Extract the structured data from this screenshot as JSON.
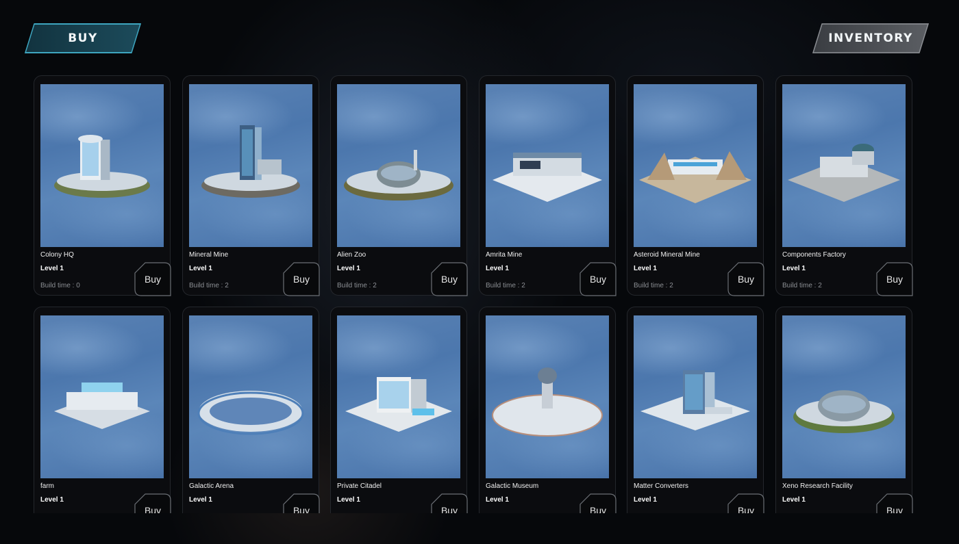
{
  "tabs": {
    "buy": "BUY",
    "inventory": "INVENTORY"
  },
  "colors": {
    "buy_tab": "#1c4b5b",
    "buy_tab_border": "#3ea6c0",
    "inventory_tab": "#5b5e63",
    "card_bg": "#0b0c0f",
    "art_bg": "#5a82b4"
  },
  "cards": [
    {
      "name": "Colony HQ",
      "level": "Level 1",
      "build_time": "Build time : 0",
      "buy": "Buy",
      "icon": "colony-hq-building-icon"
    },
    {
      "name": "Mineral Mine",
      "level": "Level 1",
      "build_time": "Build time : 2",
      "buy": "Buy",
      "icon": "mineral-mine-building-icon"
    },
    {
      "name": "Alien Zoo",
      "level": "Level 1",
      "build_time": "Build time : 2",
      "buy": "Buy",
      "icon": "alien-zoo-building-icon"
    },
    {
      "name": "Amrita Mine",
      "level": "Level 1",
      "build_time": "Build time : 2",
      "buy": "Buy",
      "icon": "amrita-mine-building-icon"
    },
    {
      "name": "Asteroid Mineral Mine",
      "level": "Level 1",
      "build_time": "Build time : 2",
      "buy": "Buy",
      "icon": "asteroid-mine-building-icon"
    },
    {
      "name": "Components Factory",
      "level": "Level 1",
      "build_time": "Build time : 2",
      "buy": "Buy",
      "icon": "components-factory-building-icon"
    },
    {
      "name": "farm",
      "level": "Level 1",
      "build_time": "",
      "buy": "Buy",
      "icon": "farm-building-icon"
    },
    {
      "name": "Galactic Arena",
      "level": "Level 1",
      "build_time": "",
      "buy": "Buy",
      "icon": "galactic-arena-building-icon"
    },
    {
      "name": "Private Citadel",
      "level": "Level 1",
      "build_time": "",
      "buy": "Buy",
      "icon": "private-citadel-building-icon"
    },
    {
      "name": "Galactic Museum",
      "level": "Level 1",
      "build_time": "",
      "buy": "Buy",
      "icon": "galactic-museum-building-icon"
    },
    {
      "name": "Matter Converters",
      "level": "Level 1",
      "build_time": "",
      "buy": "Buy",
      "icon": "matter-converters-building-icon"
    },
    {
      "name": "Xeno Research Facility",
      "level": "Level 1",
      "build_time": "",
      "buy": "Buy",
      "icon": "xeno-research-building-icon"
    }
  ]
}
